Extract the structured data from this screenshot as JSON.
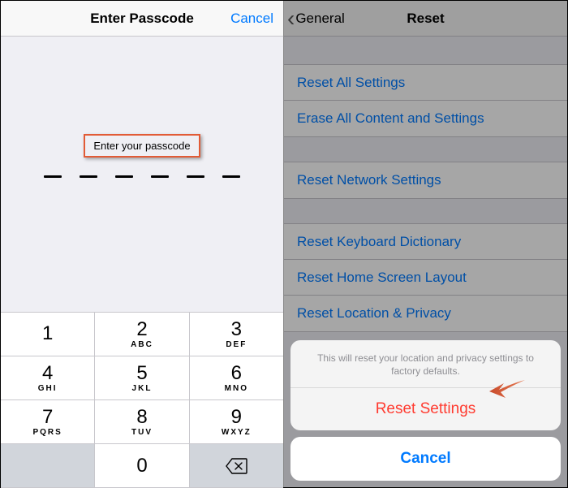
{
  "left": {
    "title": "Enter Passcode",
    "cancel": "Cancel",
    "prompt": "Enter your passcode",
    "passcode_length": 6,
    "keypad": {
      "rows": [
        [
          {
            "d": "1",
            "l": ""
          },
          {
            "d": "2",
            "l": "ABC"
          },
          {
            "d": "3",
            "l": "DEF"
          }
        ],
        [
          {
            "d": "4",
            "l": "GHI"
          },
          {
            "d": "5",
            "l": "JKL"
          },
          {
            "d": "6",
            "l": "MNO"
          }
        ],
        [
          {
            "d": "7",
            "l": "PQRS"
          },
          {
            "d": "8",
            "l": "TUV"
          },
          {
            "d": "9",
            "l": "WXYZ"
          }
        ],
        [
          {
            "blank": true
          },
          {
            "d": "0",
            "l": ""
          },
          {
            "back": true
          }
        ]
      ]
    }
  },
  "right": {
    "back": "General",
    "title": "Reset",
    "group1": [
      "Reset All Settings",
      "Erase All Content and Settings"
    ],
    "group2": [
      "Reset Network Settings"
    ],
    "group3": [
      "Reset Keyboard Dictionary",
      "Reset Home Screen Layout",
      "Reset Location & Privacy"
    ],
    "sheet": {
      "message": "This will reset your location and privacy settings to factory defaults.",
      "action": "Reset Settings",
      "cancel": "Cancel"
    }
  }
}
